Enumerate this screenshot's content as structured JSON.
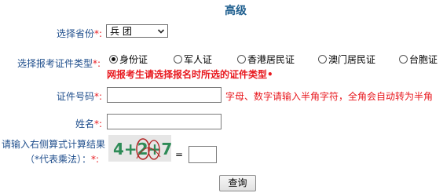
{
  "header": {
    "title": "高级"
  },
  "province": {
    "label": "选择省份",
    "required_mark": "*:",
    "selected": "兵 团"
  },
  "id_type": {
    "label": "选择报考证件类型",
    "required_mark": "*:",
    "options": [
      "身份证",
      "军人证",
      "香港居民证",
      "澳门居民证",
      "台胞证"
    ],
    "selected_index": 0,
    "warning": "网报考生请选择报名时所选的证件类型•"
  },
  "id_number": {
    "label": "证件号码",
    "required_mark": "*:",
    "value": "",
    "hint": "字母、数字请输入半角字符，全角会自动转为半角"
  },
  "name": {
    "label": "姓名",
    "required_mark": "*:",
    "value": ""
  },
  "captcha": {
    "label_line1": "请输入右侧算式计算结果",
    "label_line2": "（*代表乘法）：",
    "required_mark": "*:",
    "image_text": "4+2+7",
    "equals": "=",
    "answer": ""
  },
  "actions": {
    "query_label": "查询"
  },
  "colors": {
    "label": "#1f4e8c",
    "required": "#e8191f",
    "title": "#1f5f8f",
    "captcha_text": "#2e8b57",
    "captcha_noise": "#b22222"
  }
}
